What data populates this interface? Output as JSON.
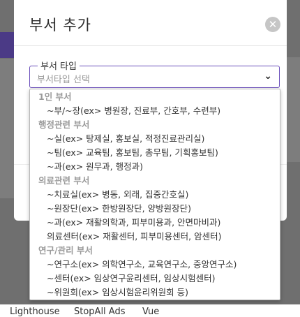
{
  "dialog": {
    "title": "부서 추가",
    "close_symbol": "✕",
    "field_label": "부서 타입",
    "select_placeholder": "부서타입 선택",
    "caret_symbol": "⌄"
  },
  "options": [
    {
      "type": "group",
      "label": "1인 부서"
    },
    {
      "type": "item",
      "label": "~부/~장(ex> 병원장, 진료부, 간호부, 수련부)"
    },
    {
      "type": "group",
      "label": "행정관련 부서"
    },
    {
      "type": "item",
      "label": "~실(ex> 탕제실, 홍보실, 적정진료관리실)"
    },
    {
      "type": "item",
      "label": "~팀(ex> 교육팀, 홍보팀, 총무팀, 기획홍보팀)"
    },
    {
      "type": "item",
      "label": "~과(ex> 원무과, 행정과)"
    },
    {
      "type": "group",
      "label": "의료관련 부서"
    },
    {
      "type": "item",
      "label": "~치료실(ex> 병동, 외래, 집중간호실)"
    },
    {
      "type": "item",
      "label": "~원장단(ex> 한방원장단, 양방원장단)"
    },
    {
      "type": "item",
      "label": "~과(ex> 재활의학과, 피부미용과, 안면마비과)"
    },
    {
      "type": "item",
      "label": "의료센터(ex> 재활센터, 피부미용센터, 암센터)"
    },
    {
      "type": "group",
      "label": "연구/관리 부서"
    },
    {
      "type": "item",
      "label": "~연구소(ex> 의학연구소, 교육연구소, 중앙연구소)"
    },
    {
      "type": "item",
      "label": "~센터(ex> 임상연구윤리센터, 임상시험센터)"
    },
    {
      "type": "item",
      "label": "~위원회(ex> 임상시험윤리위원회 등)"
    }
  ],
  "bookmarks": [
    "Lighthouse",
    "StopAll Ads",
    "Vue"
  ],
  "colors": {
    "accent": "#6b4fbb",
    "overlay": "#6f6f6f"
  }
}
